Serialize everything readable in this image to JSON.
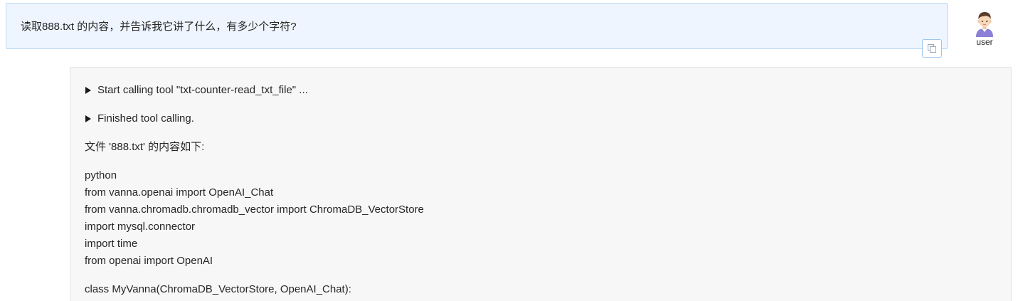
{
  "user_message": {
    "text": "读取888.txt 的内容，并告诉我它讲了什么，有多少个字符?",
    "copy_icon": "copy-icon"
  },
  "user": {
    "avatar_icon": "user-avatar-icon",
    "label": "user"
  },
  "assistant": {
    "tool_calls": [
      {
        "label": "Start calling tool \"txt-counter-read_txt_file\" ...",
        "icon": "triangle-right-icon"
      },
      {
        "label": "Finished tool calling.",
        "icon": "triangle-right-icon"
      }
    ],
    "intro": "文件 '888.txt' 的内容如下:",
    "code_lines": [
      "python",
      "from vanna.openai import OpenAI_Chat",
      "from vanna.chromadb.chromadb_vector import ChromaDB_VectorStore",
      "import mysql.connector",
      "import time",
      "from openai import OpenAI"
    ],
    "class_line": "class MyVanna(ChromaDB_VectorStore, OpenAI_Chat):"
  },
  "colors": {
    "user_bubble_bg": "#eef5fe",
    "user_bubble_border": "#bcd8f2",
    "assistant_bg": "#f7f7f7",
    "text": "#262626"
  }
}
